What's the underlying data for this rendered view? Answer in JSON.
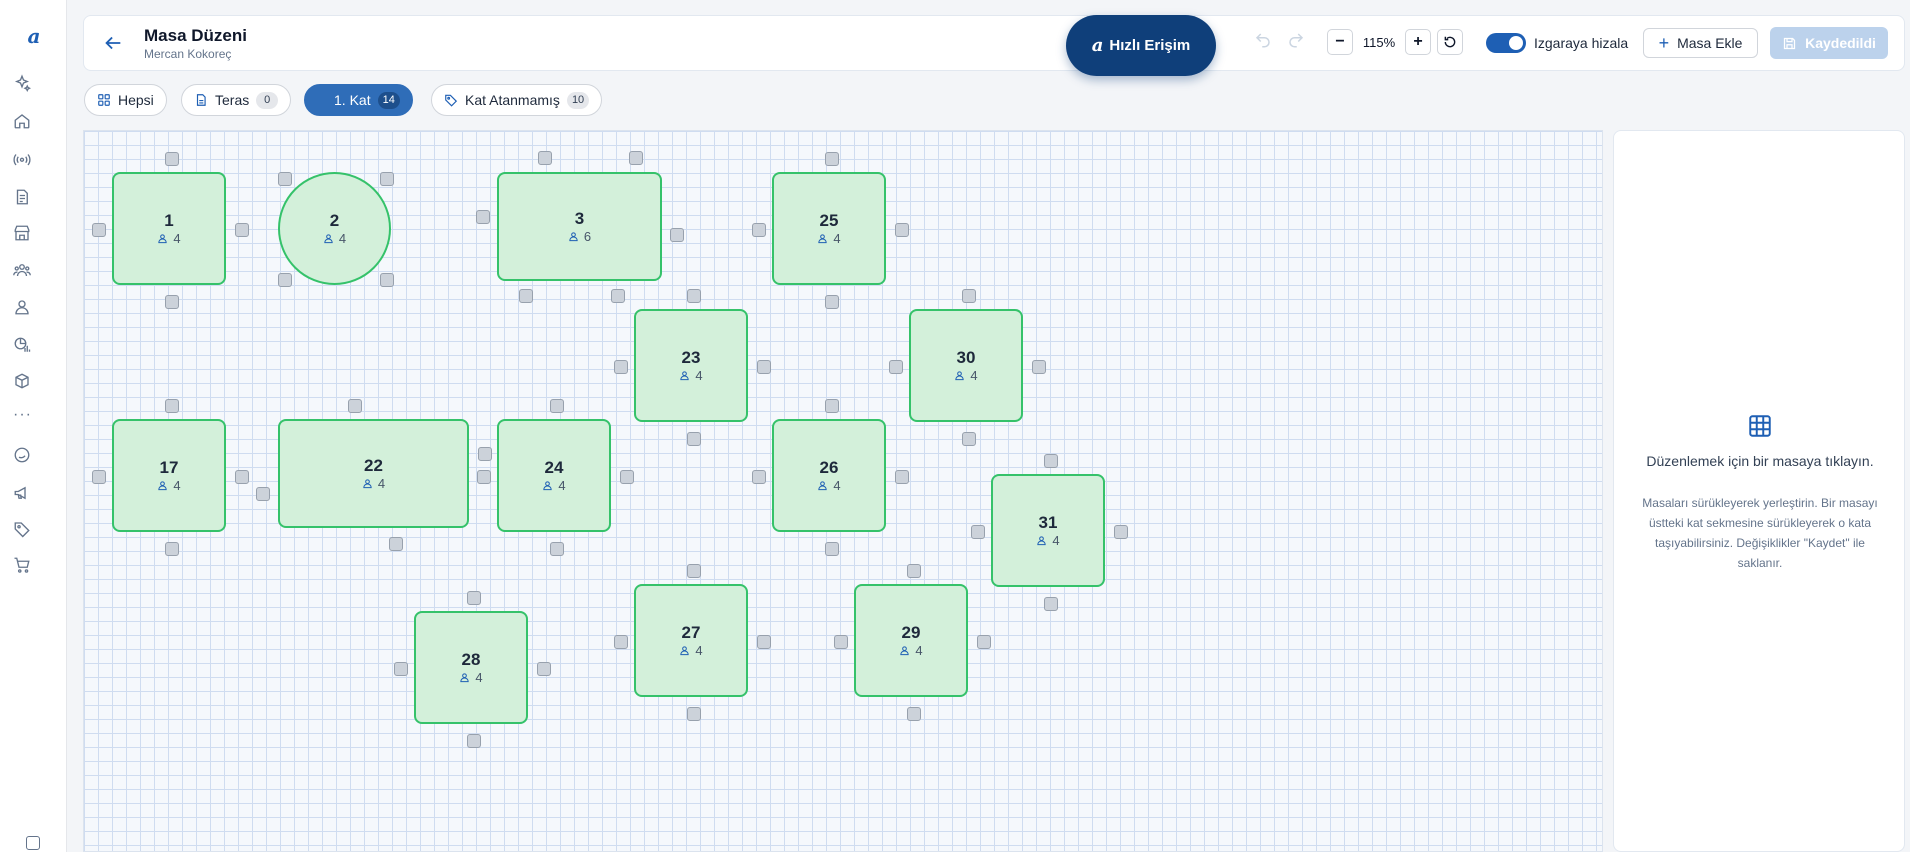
{
  "header": {
    "title": "Masa Düzeni",
    "subtitle": "Mercan Kokoreç"
  },
  "quick_access": {
    "label": "Hızlı Erişim"
  },
  "toolbar": {
    "zoom_out": "−",
    "zoom_level": "115%",
    "zoom_in": "+",
    "snap_label": "Izgaraya hizala",
    "snap_enabled": true,
    "add_table": "Masa Ekle",
    "save": "Kaydedildi"
  },
  "tabs": [
    {
      "label": "Hepsi",
      "count": null,
      "active": false
    },
    {
      "label": "Teras",
      "count": "0",
      "active": false
    },
    {
      "label": "1. Kat",
      "count": "14",
      "active": true
    },
    {
      "label": "Kat Atanmamış",
      "count": "10",
      "active": false
    }
  ],
  "tables": [
    {
      "number": "1",
      "capacity": "4"
    },
    {
      "number": "2",
      "capacity": "4",
      "shape": "round"
    },
    {
      "number": "3",
      "capacity": "6"
    },
    {
      "number": "25",
      "capacity": "4"
    },
    {
      "number": "23",
      "capacity": "4"
    },
    {
      "number": "30",
      "capacity": "4"
    },
    {
      "number": "17",
      "capacity": "4"
    },
    {
      "number": "22",
      "capacity": "4"
    },
    {
      "number": "24",
      "capacity": "4"
    },
    {
      "number": "26",
      "capacity": "4"
    },
    {
      "number": "31",
      "capacity": "4"
    },
    {
      "number": "28",
      "capacity": "4"
    },
    {
      "number": "27",
      "capacity": "4"
    },
    {
      "number": "29",
      "capacity": "4"
    }
  ],
  "panel": {
    "title": "Düzenlemek için bir masaya tıklayın.",
    "help": "Masaları sürükleyerek yerleştirin. Bir masayı üstteki kat sekmesine sürükleyerek o kata taşıyabilirsiniz. Değişiklikler \"Kaydet\" ile saklanır."
  },
  "colors": {
    "accent": "#1e5fb4",
    "table_fill": "#d3f0da",
    "table_border": "#35c26a",
    "quick_access_bg": "#0f3f7a"
  }
}
